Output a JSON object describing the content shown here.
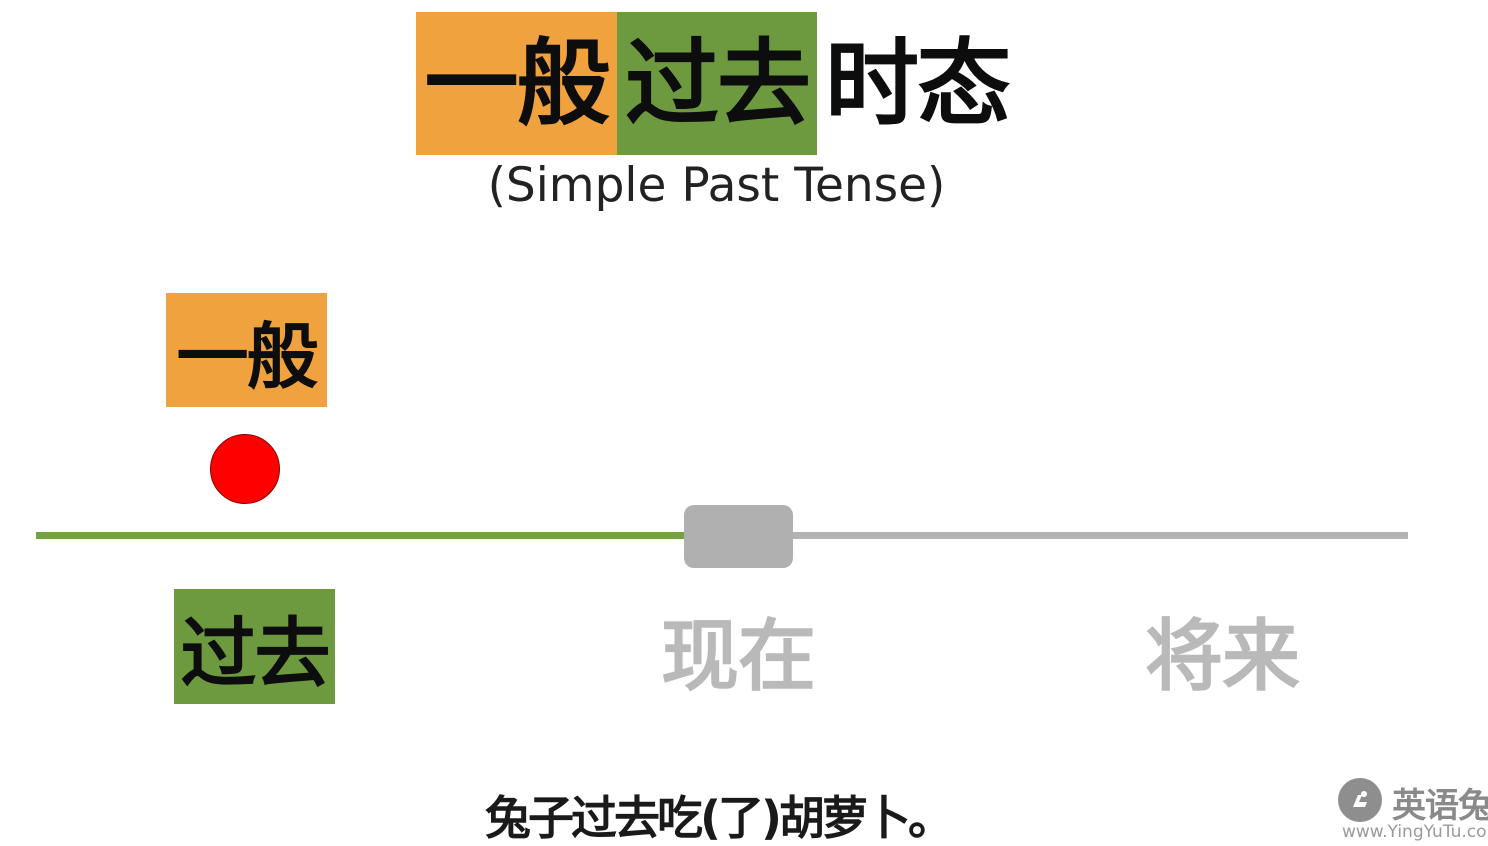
{
  "colors": {
    "general_orange": "#f0a23e",
    "past_green": "#6d9a3e",
    "timeline_past": "#75a23f",
    "timeline_future": "#b3b3b3",
    "now_handle": "#b0b0b0",
    "event_dot": "#ff0000",
    "muted_label": "#b9b9b9"
  },
  "title": {
    "general": "一般",
    "past": "过去",
    "tense": "时态",
    "subtitle": "(Simple Past Tense)"
  },
  "diagram": {
    "general_tag": "一般",
    "event_dot_icon": "red-dot-icon",
    "now_handle_icon": "slider-handle-icon",
    "labels": {
      "past": "过去",
      "present": "现在",
      "future": "将来"
    }
  },
  "caption": "兔子过去吃(了)胡萝卜。",
  "watermark": {
    "logo_icon": "rabbit-logo-icon",
    "name": "英语兔",
    "url": "www.YingYuTu.com"
  }
}
